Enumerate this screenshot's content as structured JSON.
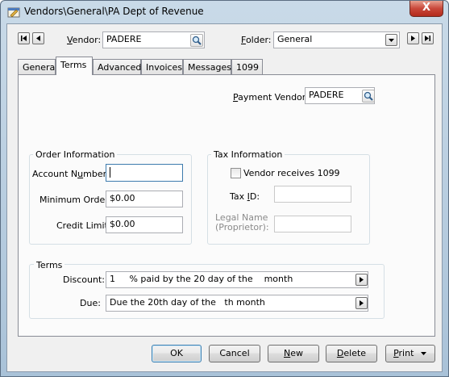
{
  "window": {
    "title": "Vendors\\General\\PA Dept of Revenue",
    "close_glyph": "X"
  },
  "header": {
    "vendor_label_pre": "",
    "vendor_label_u": "V",
    "vendor_label_post": "endor:",
    "vendor_value": "PADERE",
    "folder_label_pre": "",
    "folder_label_u": "F",
    "folder_label_post": "older:",
    "folder_value": "General"
  },
  "tabs": [
    {
      "label": "General"
    },
    {
      "label": "Terms"
    },
    {
      "label": "Advanced"
    },
    {
      "label": "Invoices"
    },
    {
      "label": "Messages"
    },
    {
      "label": "1099"
    }
  ],
  "payment_vendor": {
    "label_pre": "",
    "label_u": "P",
    "label_post": "ayment Vendor:",
    "value": "PADERE"
  },
  "order_info": {
    "title": "Order Information",
    "account_label_pre": "Account N",
    "account_label_u": "u",
    "account_label_post": "mber:",
    "account_value": "",
    "min_order_label": "Minimum Order:",
    "min_order_value": "$0.00",
    "credit_limit_label": "Credit Limit",
    "credit_limit_value": "$0.00"
  },
  "tax_info": {
    "title": "Tax Information",
    "receives_1099_label": "Vendor receives 1099",
    "receives_1099_checked": false,
    "tax_id_label_pre": "Tax ",
    "tax_id_label_u": "I",
    "tax_id_label_post": "D:",
    "tax_id_value": "",
    "legal_name_label_line1": "Legal Name",
    "legal_name_label_line2": "(Proprietor):",
    "legal_name_value": ""
  },
  "terms": {
    "title": "Terms",
    "discount_label": "Discount:",
    "discount_value": "1     % paid by the 20 day of the    month",
    "due_label": "Due:",
    "due_value": "Due the 20th day of the   th month"
  },
  "buttons": {
    "ok": "OK",
    "cancel": "Cancel",
    "new_pre": "",
    "new_u": "N",
    "new_post": "ew",
    "delete_pre": "",
    "delete_u": "D",
    "delete_post": "elete",
    "print_pre": "",
    "print_u": "P",
    "print_post": "rint"
  },
  "icons": {
    "title": "window-icon",
    "first": "first-record-icon",
    "prev": "previous-record-icon",
    "next": "next-record-icon",
    "last": "last-record-icon",
    "lookup": "magnifier-icon",
    "dropdown": "chevron-down-icon",
    "expand": "arrow-right-icon"
  }
}
